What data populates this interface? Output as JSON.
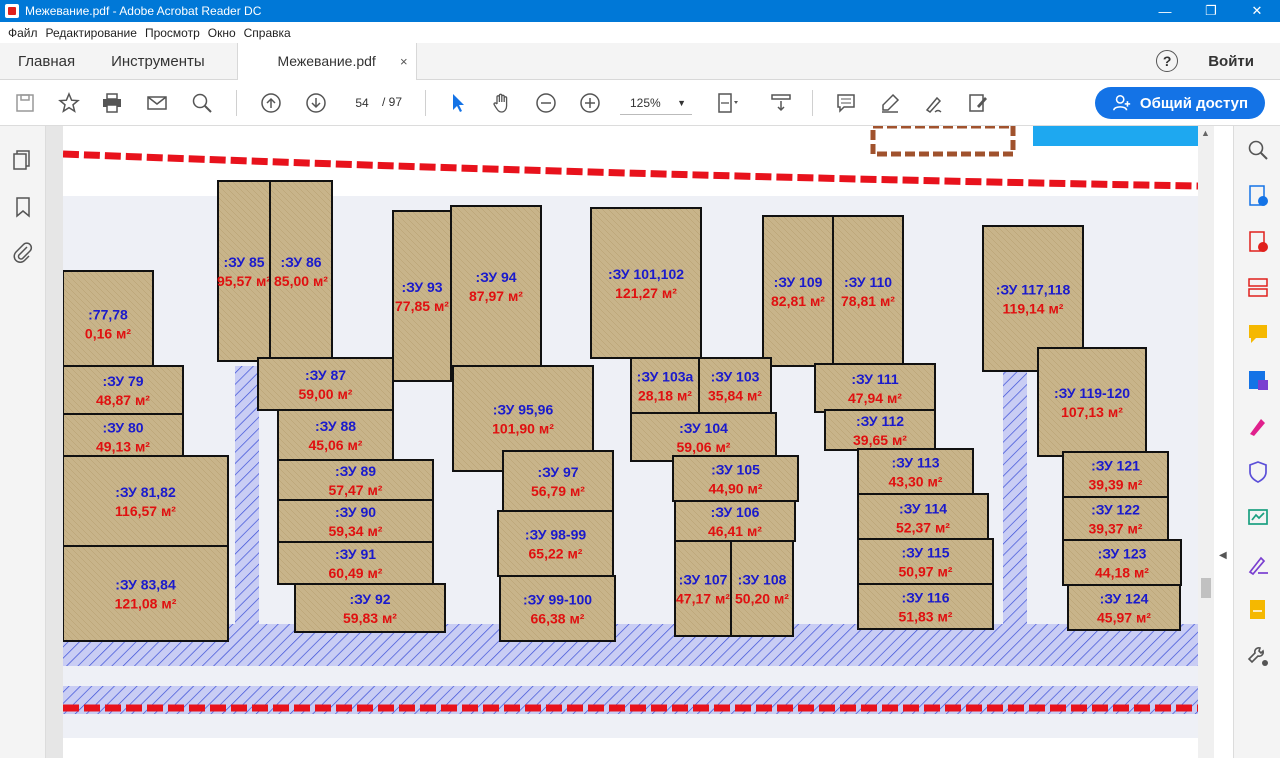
{
  "window": {
    "title": "Межевание.pdf - Adobe Acrobat Reader DC",
    "minimize": "—",
    "maximize": "❐",
    "close": "✕"
  },
  "menu": [
    "Файл",
    "Редактирование",
    "Просмотр",
    "Окно",
    "Справка"
  ],
  "tabs": {
    "home": "Главная",
    "tools": "Инструменты",
    "document": "Межевание.pdf",
    "close": "×"
  },
  "header": {
    "help": "?",
    "login": "Войти"
  },
  "toolbar": {
    "page_current": "54",
    "page_total": "/  97",
    "zoom": "125%",
    "share_label": "Общий доступ"
  },
  "plots": [
    {
      "id": "ЗУ 85",
      "area": "95,57 м²"
    },
    {
      "id": "ЗУ 86",
      "area": "85,00 м²"
    },
    {
      "id": "ЗУ 93",
      "area": "77,85 м²"
    },
    {
      "id": "ЗУ 94",
      "area": "87,97 м²"
    },
    {
      "id": "ЗУ 101,102",
      "area": "121,27 м²"
    },
    {
      "id": "ЗУ 109",
      "area": "82,81 м²"
    },
    {
      "id": "ЗУ 110",
      "area": "78,81 м²"
    },
    {
      "id": "ЗУ 117,118",
      "area": "119,14 м²"
    },
    {
      "id": "77,78",
      "area": "0,16 м²"
    },
    {
      "id": "ЗУ 79",
      "area": "48,87 м²"
    },
    {
      "id": "ЗУ 80",
      "area": "49,13 м²"
    },
    {
      "id": "ЗУ 81,82",
      "area": "116,57 м²"
    },
    {
      "id": "ЗУ 83,84",
      "area": "121,08 м²"
    },
    {
      "id": "ЗУ 87",
      "area": "59,00 м²"
    },
    {
      "id": "ЗУ 88",
      "area": "45,06 м²"
    },
    {
      "id": "ЗУ 89",
      "area": "57,47 м²"
    },
    {
      "id": "ЗУ 90",
      "area": "59,34 м²"
    },
    {
      "id": "ЗУ 91",
      "area": "60,49 м²"
    },
    {
      "id": "ЗУ 92",
      "area": "59,83 м²"
    },
    {
      "id": "ЗУ 95,96",
      "area": "101,90 м²"
    },
    {
      "id": "ЗУ 97",
      "area": "56,79 м²"
    },
    {
      "id": "ЗУ 98-99",
      "area": "65,22 м²"
    },
    {
      "id": "ЗУ 99-100",
      "area": "66,38 м²"
    },
    {
      "id": "ЗУ 103а",
      "area": "28,18 м²"
    },
    {
      "id": "ЗУ 103",
      "area": "35,84 м²"
    },
    {
      "id": "ЗУ 104",
      "area": "59,06 м²"
    },
    {
      "id": "ЗУ 105",
      "area": "44,90 м²"
    },
    {
      "id": "ЗУ 106",
      "area": "46,41 м²"
    },
    {
      "id": "ЗУ 107",
      "area": "47,17 м²"
    },
    {
      "id": "ЗУ 108",
      "area": "50,20 м²"
    },
    {
      "id": "ЗУ 111",
      "area": "47,94 м²"
    },
    {
      "id": "ЗУ 112",
      "area": "39,65 м²"
    },
    {
      "id": "ЗУ 113",
      "area": "43,30 м²"
    },
    {
      "id": "ЗУ 114",
      "area": "52,37 м²"
    },
    {
      "id": "ЗУ 115",
      "area": "50,97 м²"
    },
    {
      "id": "ЗУ 116",
      "area": "51,83 м²"
    },
    {
      "id": "ЗУ 119-120",
      "area": "107,13 м²"
    },
    {
      "id": "ЗУ 121",
      "area": "39,39 м²"
    },
    {
      "id": "ЗУ 122",
      "area": "39,37 м²"
    },
    {
      "id": "ЗУ 123",
      "area": "44,18 м²"
    },
    {
      "id": "ЗУ 124",
      "area": "45,97 м²"
    }
  ],
  "colors": {
    "titlebar": "#0078d7",
    "accent": "#1473e6",
    "plot_fill": "#c8b48a",
    "boundary_red": "#e8121c",
    "road_hatch": "#3b4fd8",
    "plot_label": "#1a1acc",
    "area_label": "#e01010"
  }
}
